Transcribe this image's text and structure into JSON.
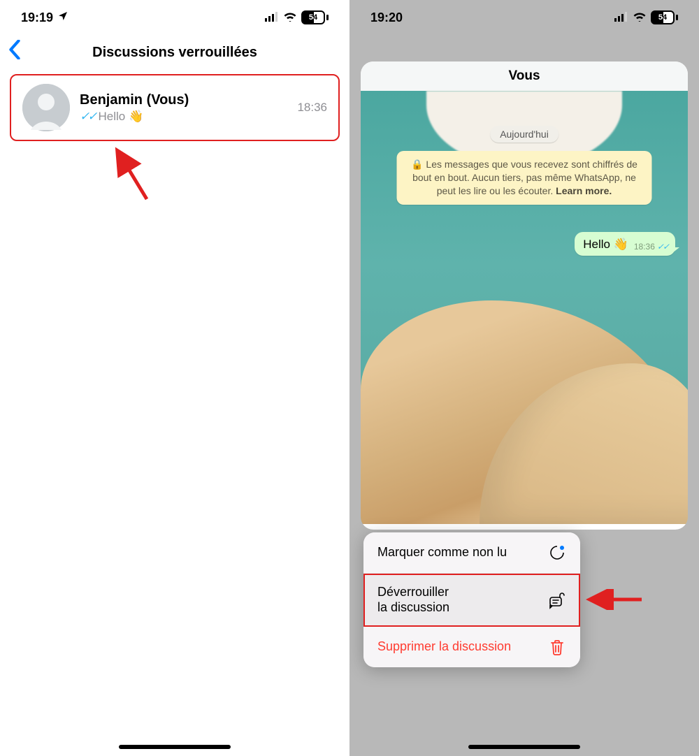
{
  "left": {
    "status": {
      "time": "19:19",
      "battery": "54"
    },
    "header": {
      "title": "Discussions verrouillées"
    },
    "chat": {
      "name": "Benjamin (Vous)",
      "preview": "Hello 👋",
      "time": "18:36"
    }
  },
  "right": {
    "status": {
      "time": "19:20",
      "battery": "54"
    },
    "card": {
      "title": "Vous",
      "date_pill": "Aujourd'hui",
      "encryption_notice": "Les messages que vous recevez sont chiffrés de bout en bout. Aucun tiers, pas même WhatsApp, ne peut les lire ou les écouter.",
      "encryption_cta": "Learn more.",
      "message": {
        "text": "Hello 👋",
        "time": "18:36"
      }
    },
    "menu": {
      "mark_unread": "Marquer comme non lu",
      "unlock_line1": "Déverrouiller",
      "unlock_line2": "la discussion",
      "delete": "Supprimer la discussion"
    }
  }
}
